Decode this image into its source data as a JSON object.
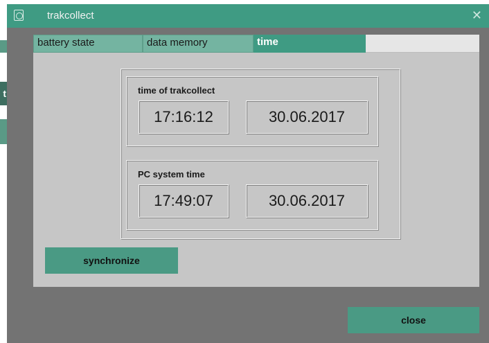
{
  "window": {
    "title": "trakcollect",
    "close_glyph": "✕",
    "icon": "app-icon"
  },
  "background": {
    "partial_text": "t"
  },
  "tabs": [
    {
      "label": "battery state",
      "active": false
    },
    {
      "label": "data memory",
      "active": false
    },
    {
      "label": "time",
      "active": true
    }
  ],
  "device_time": {
    "label": "time of trakcollect",
    "time": "17:16:12",
    "date": "30.06.2017"
  },
  "pc_time": {
    "label": "PC system time",
    "time": "17:49:07",
    "date": "30.06.2017"
  },
  "buttons": {
    "synchronize": "synchronize",
    "close": "close"
  },
  "colors": {
    "accent": "#3f9b83",
    "button": "#4a9a84",
    "panel": "#c6c6c6",
    "window_bg": "#737373"
  }
}
